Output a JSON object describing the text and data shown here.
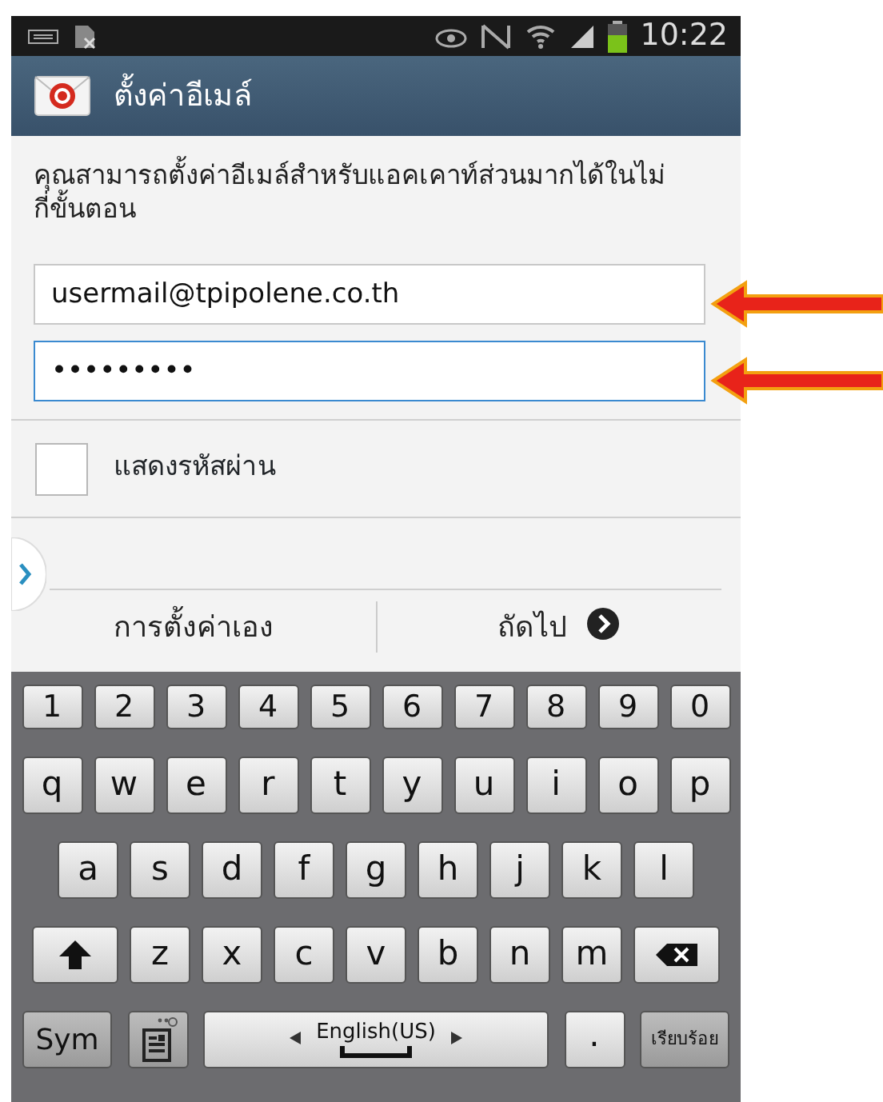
{
  "status_bar": {
    "time": "10:22"
  },
  "header": {
    "title": "ตั้งค่าอีเมล์"
  },
  "intro": "คุณสามารถตั้งค่าอีเมล์สำหรับแอคเคาท์ส่วนมากได้ในไม่กี่ขั้นตอน",
  "fields": [
    {
      "value": "usermail@tpipolene.co.th",
      "focused": false,
      "marked": true
    },
    {
      "value": "•••••••••",
      "focused": true,
      "marked": true
    }
  ],
  "show_password": {
    "label": "แสดงรหัสผ่าน",
    "checked": false
  },
  "actions": [
    {
      "label": "การตั้งค่าเอง",
      "kind": "plain"
    },
    {
      "label": "ถัดไป",
      "kind": "next"
    }
  ],
  "keyboard": {
    "rows": [
      {
        "keys": [
          {
            "kind": "num",
            "label": "1"
          },
          {
            "kind": "num",
            "label": "2"
          },
          {
            "kind": "num",
            "label": "3"
          },
          {
            "kind": "num",
            "label": "4"
          },
          {
            "kind": "num",
            "label": "5"
          },
          {
            "kind": "num",
            "label": "6"
          },
          {
            "kind": "num",
            "label": "7"
          },
          {
            "kind": "num",
            "label": "8"
          },
          {
            "kind": "num",
            "label": "9"
          },
          {
            "kind": "num",
            "label": "0"
          }
        ]
      },
      {
        "keys": [
          {
            "kind": "char",
            "label": "q"
          },
          {
            "kind": "char",
            "label": "w"
          },
          {
            "kind": "char",
            "label": "e"
          },
          {
            "kind": "char",
            "label": "r"
          },
          {
            "kind": "char",
            "label": "t"
          },
          {
            "kind": "char",
            "label": "y"
          },
          {
            "kind": "char",
            "label": "u"
          },
          {
            "kind": "char",
            "label": "i"
          },
          {
            "kind": "char",
            "label": "o"
          },
          {
            "kind": "char",
            "label": "p"
          }
        ]
      },
      {
        "keys": [
          {
            "kind": "char",
            "label": "a"
          },
          {
            "kind": "char",
            "label": "s"
          },
          {
            "kind": "char",
            "label": "d"
          },
          {
            "kind": "char",
            "label": "f"
          },
          {
            "kind": "char",
            "label": "g"
          },
          {
            "kind": "char",
            "label": "h"
          },
          {
            "kind": "char",
            "label": "j"
          },
          {
            "kind": "char",
            "label": "k"
          },
          {
            "kind": "char",
            "label": "l"
          }
        ]
      },
      {
        "keys": [
          {
            "kind": "shift"
          },
          {
            "kind": "char",
            "label": "z"
          },
          {
            "kind": "char",
            "label": "x"
          },
          {
            "kind": "char",
            "label": "c"
          },
          {
            "kind": "char",
            "label": "v"
          },
          {
            "kind": "char",
            "label": "b"
          },
          {
            "kind": "char",
            "label": "n"
          },
          {
            "kind": "char",
            "label": "m"
          },
          {
            "kind": "backspace"
          }
        ]
      },
      {
        "keys": [
          {
            "kind": "sym",
            "label": "Sym"
          },
          {
            "kind": "clipboard"
          },
          {
            "kind": "space",
            "label": "English(US)"
          },
          {
            "kind": "period",
            "label": "."
          },
          {
            "kind": "done",
            "label": "เรียบร้อย"
          }
        ]
      }
    ]
  }
}
